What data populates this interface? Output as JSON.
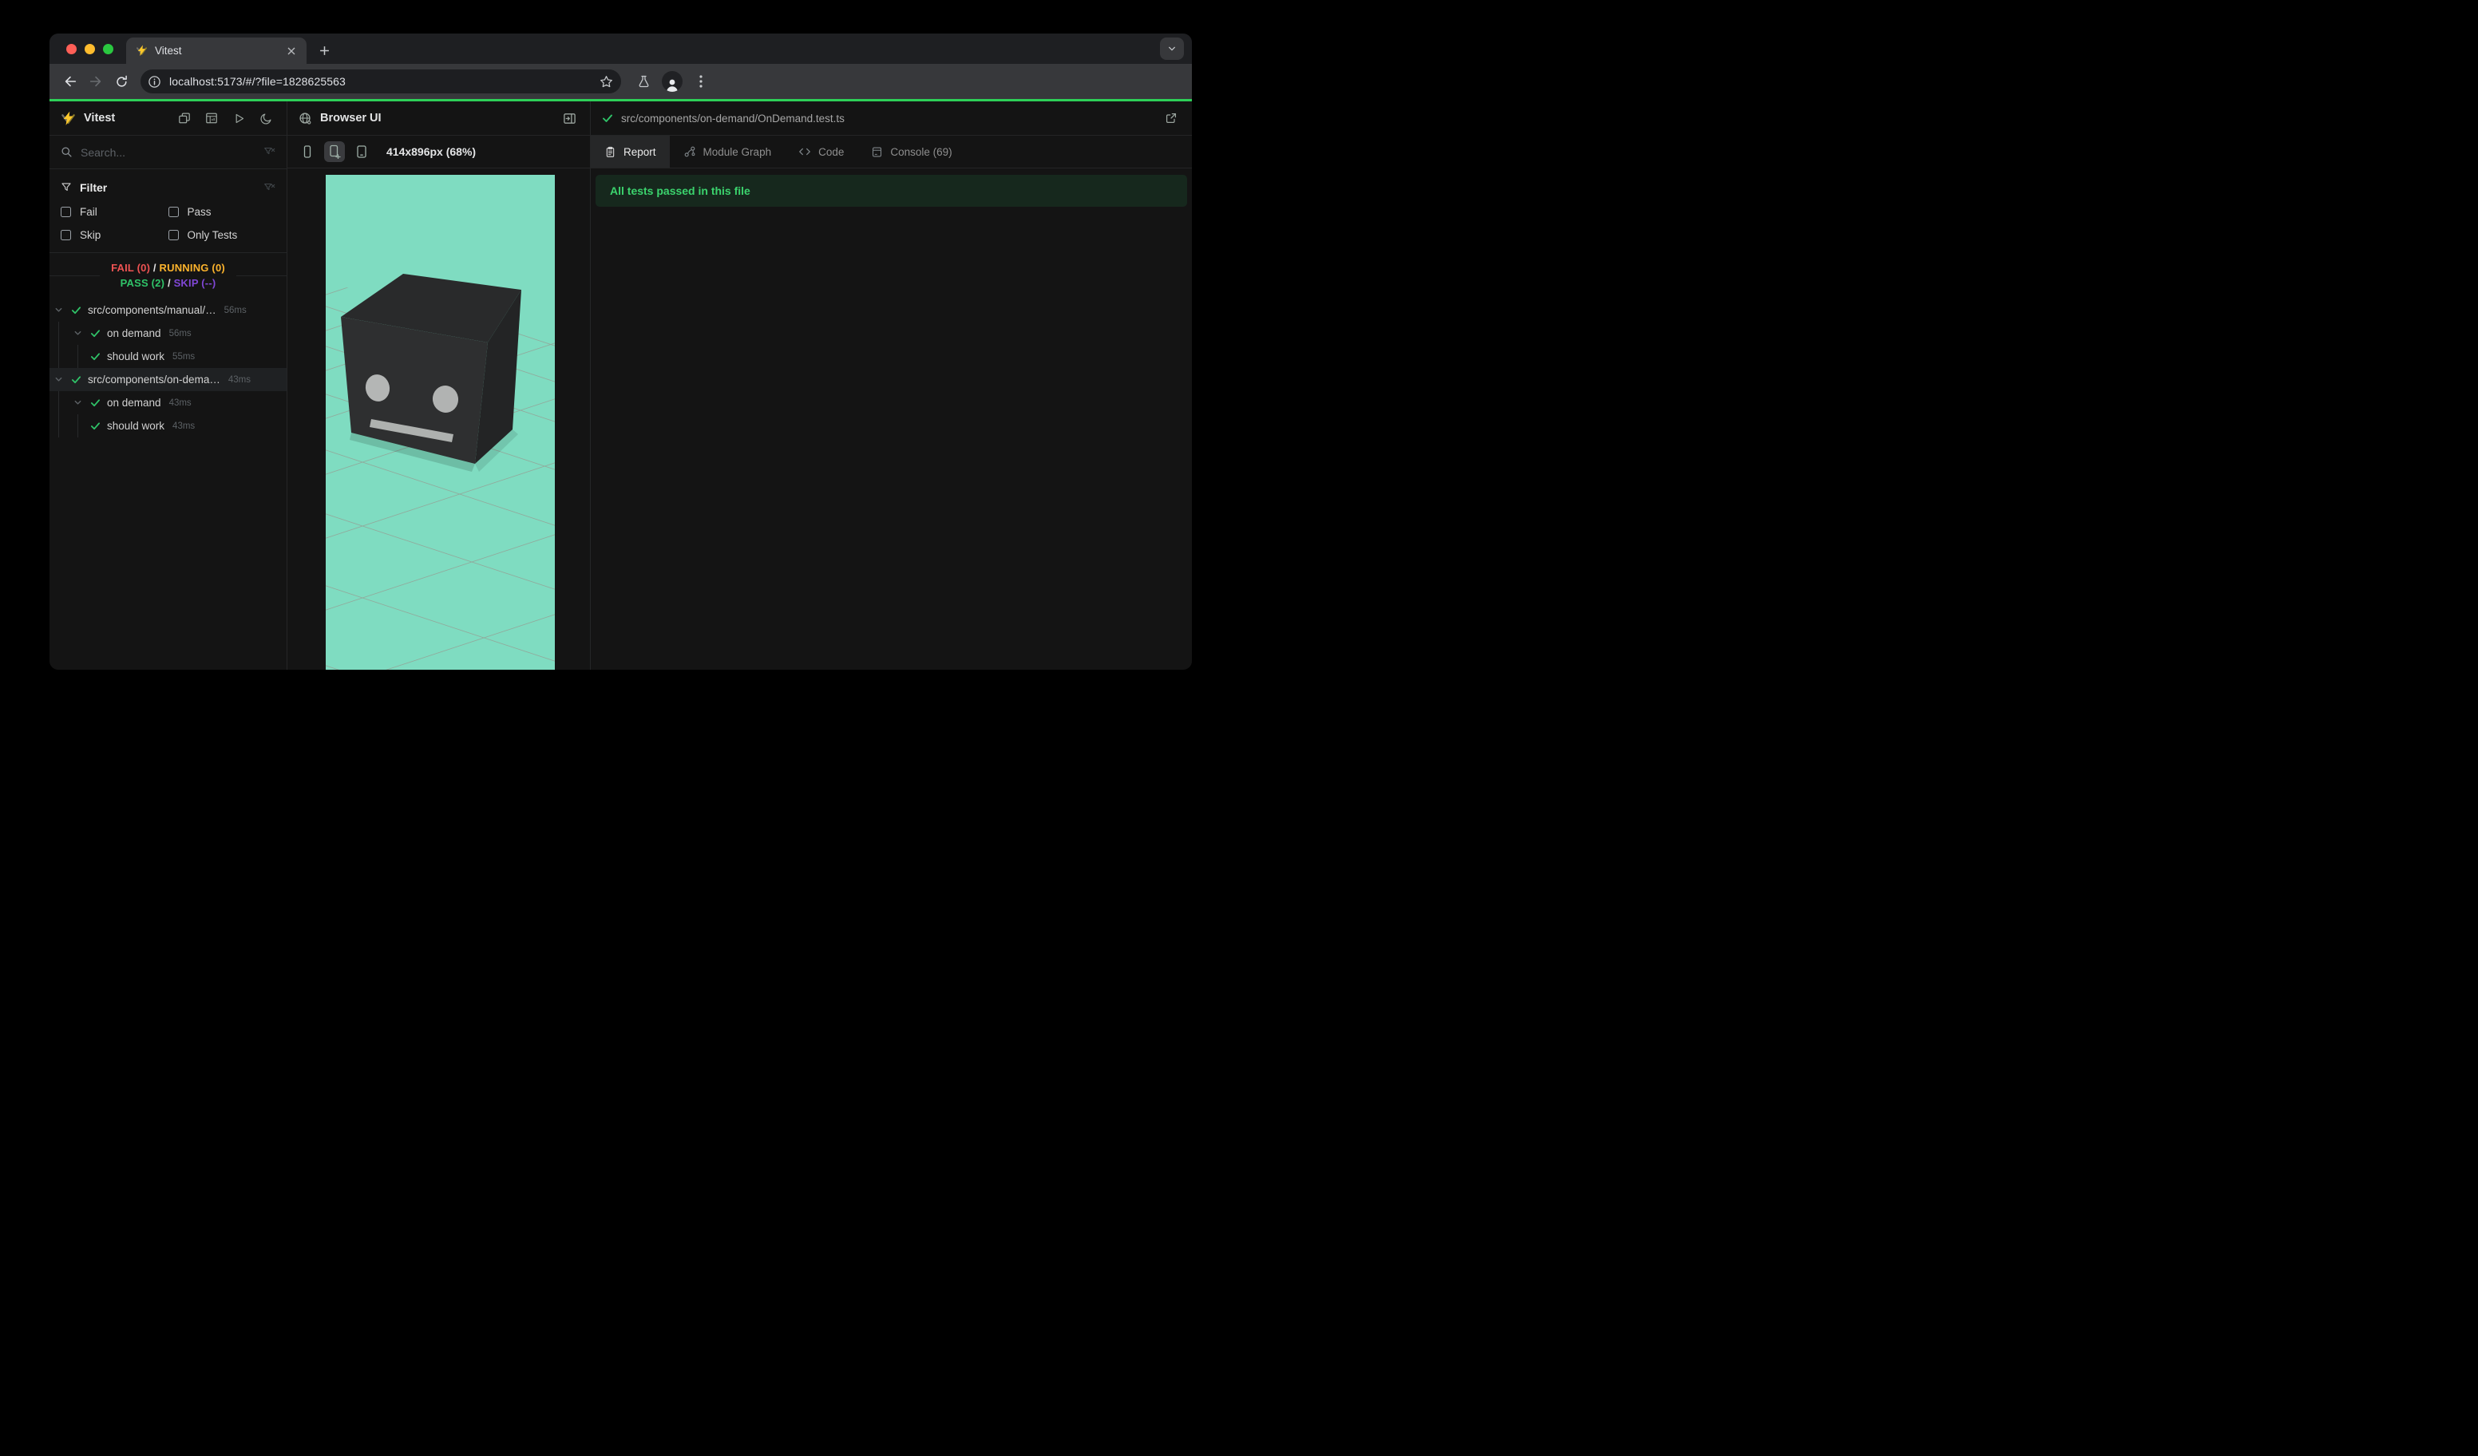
{
  "browser": {
    "tab_title": "Vitest",
    "url": "localhost:5173/#/?file=1828625563"
  },
  "sidebar": {
    "app_title": "Vitest",
    "search_placeholder": "Search...",
    "filter": {
      "title": "Filter",
      "options": [
        "Fail",
        "Pass",
        "Skip",
        "Only Tests"
      ]
    },
    "summary": {
      "fail": "FAIL (0)",
      "running": "RUNNING (0)",
      "pass": "PASS (2)",
      "skip": "SKIP (--)",
      "sep": "/"
    },
    "tree": [
      {
        "label": "src/components/manual/…",
        "duration": "56ms",
        "level": 0,
        "chevron": true,
        "selected": false
      },
      {
        "label": "on demand",
        "duration": "56ms",
        "level": 1,
        "chevron": true,
        "selected": false
      },
      {
        "label": "should work",
        "duration": "55ms",
        "level": 2,
        "chevron": false,
        "selected": false
      },
      {
        "label": "src/components/on-dema…",
        "duration": "43ms",
        "level": 0,
        "chevron": true,
        "selected": true
      },
      {
        "label": "on demand",
        "duration": "43ms",
        "level": 1,
        "chevron": true,
        "selected": false
      },
      {
        "label": "should work",
        "duration": "43ms",
        "level": 2,
        "chevron": false,
        "selected": false
      }
    ]
  },
  "browser_panel": {
    "title": "Browser UI",
    "viewport_label": "414x896px (68%)"
  },
  "report_panel": {
    "file_path": "src/components/on-demand/OnDemand.test.ts",
    "tabs": [
      {
        "label": "Report",
        "icon": "report",
        "active": true
      },
      {
        "label": "Module Graph",
        "icon": "graph",
        "active": false
      },
      {
        "label": "Code",
        "icon": "code",
        "active": false
      },
      {
        "label": "Console (69)",
        "icon": "console",
        "active": false
      }
    ],
    "banner": "All tests passed in this file"
  },
  "colors": {
    "pass_green": "#2fc368",
    "fail_red": "#ee5353",
    "running_amber": "#fcb32c",
    "skip_purple": "#8047d6",
    "progress_green": "#2ed058",
    "viewport_teal": "#7fdcc1",
    "banner_bg": "#16281d"
  }
}
